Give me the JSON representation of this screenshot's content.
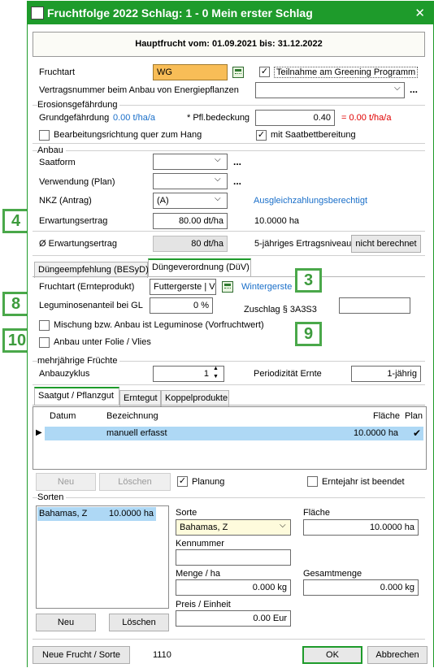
{
  "window": {
    "title": "Fruchtfolge 2022 Schlag: 1 - 0 Mein erster Schlag",
    "close_glyph": "✕"
  },
  "header": "Hauptfrucht vom: 01.09.2021 bis: 31.12.2022",
  "crop": {
    "label": "Fruchtart",
    "value": "WG",
    "greening_checked": true,
    "greening_label": "Teilnahme am Greening Programm"
  },
  "contract": {
    "label": "Vertragsnummer beim Anbau von Energiepflanzen",
    "value": "",
    "more": "..."
  },
  "erosion": {
    "title": "Erosionsgefährdung",
    "base_label": "Grundgefährdung",
    "base_value": "0.00 t/ha/a",
    "cover_label": "* Pfl.bedeckung",
    "cover_value": "0.40",
    "result": "= 0.00 t/ha/a",
    "direction_label": "Bearbeitungsrichtung quer zum Hang",
    "direction_checked": false,
    "seedbed_label": "mit Saatbettbereitung",
    "seedbed_checked": true
  },
  "anbau": {
    "title": "Anbau",
    "saatform_label": "Saatform",
    "saatform_value": "",
    "verwendung_label": "Verwendung (Plan)",
    "verwendung_value": "",
    "nkz_label": "NKZ  (Antrag)",
    "nkz_value": "(A)",
    "ausgleich_link": "Ausgleichzahlungsberechtigt",
    "ertrag_label": "Erwartungsertrag",
    "ertrag_value": "80.00 dt/ha",
    "area": "10.0000 ha",
    "more": "..."
  },
  "avg": {
    "label": "Ø Erwartungsertrag",
    "value": "80 dt/ha",
    "niveau_label": "5-jähriges Ertragsniveau",
    "niveau_button": "nicht berechnet"
  },
  "tabs_top": [
    "Düngeempfehlung (BESyD)",
    "Düngeverordnung (DüV)"
  ],
  "duev": {
    "fruchtart_label": "Fruchtart (Ernteprodukt)",
    "fruchtart_value": "Futtergerste | V",
    "fruchtart_link": "Wintergerste",
    "legum_label": "Leguminosenanteil bei GL",
    "legum_value": "0 %",
    "zuschlag_label": "Zuschlag § 3A3S3",
    "zuschlag_value": "",
    "mischung_label": "Mischung bzw. Anbau ist Leguminose (Vorfruchtwert)",
    "folie_label": "Anbau unter Folie / Vlies"
  },
  "mehrjaehrig": {
    "title": "mehrjährige Früchte",
    "zyklus_label": "Anbauzyklus",
    "zyklus_value": "1",
    "period_label": "Periodizität Ernte",
    "period_value": "1-jährig"
  },
  "tabs_bottom": [
    "Saatgut / Pflanzgut",
    "Erntegut",
    "Koppelprodukte"
  ],
  "saatgut_table": {
    "columns": [
      "Datum",
      "Bezeichnung",
      "Fläche",
      "Plan"
    ],
    "rows": [
      {
        "datum": "",
        "bezeichnung": "manuell erfasst",
        "flaeche": "10.0000 ha",
        "plan": "✔"
      }
    ]
  },
  "saatgut_actions": {
    "neu": "Neu",
    "loeschen": "Löschen",
    "planung_label": "Planung",
    "planung_checked": true,
    "erntejahr_label": "Erntejahr ist beendet",
    "erntejahr_checked": false
  },
  "sorten": {
    "title": "Sorten",
    "list": [
      {
        "name": "Bahamas, Z",
        "area": "10.0000 ha"
      }
    ],
    "sorte_label": "Sorte",
    "sorte_value": "Bahamas, Z",
    "flaeche_label": "Fläche",
    "flaeche_value": "10.0000 ha",
    "kennnummer_label": "Kennummer",
    "kennnummer_value": "",
    "menge_label": "Menge / ha",
    "menge_value": "0.000 kg",
    "gesamt_label": "Gesamtmenge",
    "gesamt_value": "0.000 kg",
    "preis_label": "Preis / Einheit",
    "preis_value": "0.00 Eur",
    "neu": "Neu",
    "loeschen": "Löschen"
  },
  "footer": {
    "new_button": "Neue Frucht / Sorte",
    "code": "1110",
    "ok": "OK",
    "cancel": "Abbrechen"
  },
  "callouts": [
    "4",
    "3",
    "8",
    "9",
    "10"
  ],
  "colors": {
    "title_bar": "#1e9b2b",
    "crop_field": "#f8bd57",
    "link": "#1a6fc9",
    "alert": "#e00000",
    "selection": "#aed8f5",
    "callout": "#4aa84a"
  }
}
